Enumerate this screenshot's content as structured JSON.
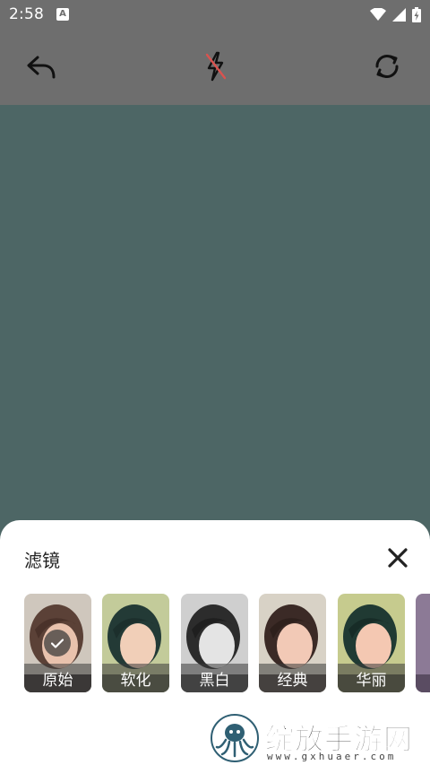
{
  "status_bar": {
    "time": "2:58",
    "notification_letter": "A"
  },
  "toolbar": {
    "back_icon": "undo-arrow-icon",
    "flash_icon": "flash-off-icon",
    "rotate_icon": "switch-camera-icon"
  },
  "sheet": {
    "title": "滤镜",
    "close_icon": "close-icon",
    "filters": [
      {
        "label": "原始",
        "selected": true,
        "tone": "original"
      },
      {
        "label": "软化",
        "selected": false,
        "tone": "soft"
      },
      {
        "label": "黑白",
        "selected": false,
        "tone": "bw"
      },
      {
        "label": "经典",
        "selected": false,
        "tone": "classic"
      },
      {
        "label": "华丽",
        "selected": false,
        "tone": "gorgeous"
      }
    ]
  },
  "watermark": {
    "text": "绽放手游网",
    "url": "www.gxhuaer.com"
  },
  "colors": {
    "status_bar_bg": "#6e6e6e",
    "preview_bg": "#4d6665",
    "sheet_bg": "#ffffff",
    "flash_slash": "#d9534f"
  }
}
